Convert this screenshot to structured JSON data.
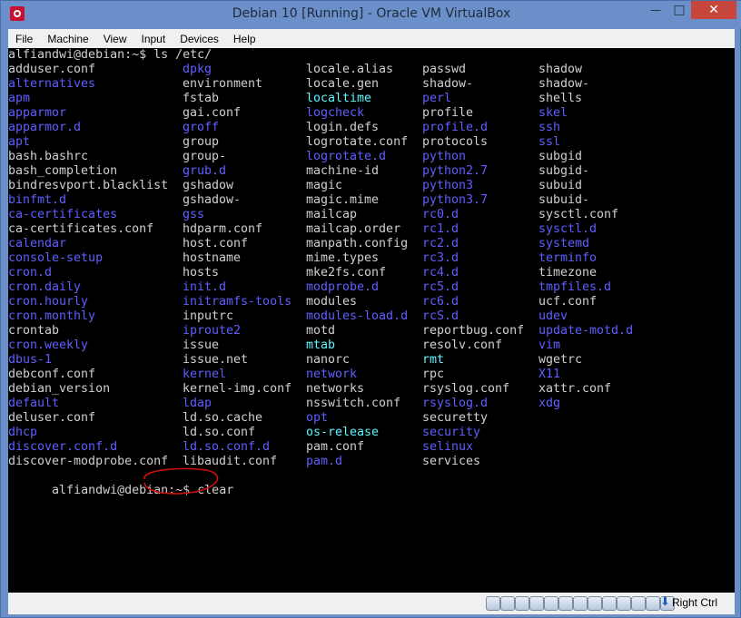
{
  "window": {
    "title": "Debian 10 [Running] - Oracle VM VirtualBox",
    "close_symbol": "✕",
    "min_symbol": "—",
    "max_symbol": "□"
  },
  "menubar": {
    "items": [
      "File",
      "Machine",
      "View",
      "Input",
      "Devices",
      "Help"
    ]
  },
  "terminal": {
    "prompt_line": "alfiandwi@debian:~$ ls /etc/",
    "final_prompt": "alfiandwi@debian:~$",
    "final_command": "clear",
    "colors": {
      "file": "#d0d0d0",
      "dir": "#5f5fff",
      "link": "#5ff5ff",
      "background": "#000000"
    },
    "rows": [
      [
        [
          "adduser.conf",
          "file"
        ],
        [
          "dpkg",
          "dir"
        ],
        [
          "locale.alias",
          "file"
        ],
        [
          "passwd",
          "file"
        ],
        [
          "shadow",
          "file"
        ]
      ],
      [
        [
          "alternatives",
          "dir"
        ],
        [
          "environment",
          "file"
        ],
        [
          "locale.gen",
          "file"
        ],
        [
          "shadow-",
          "file"
        ],
        [
          "shadow-",
          "file"
        ]
      ],
      [
        [
          "apm",
          "dir"
        ],
        [
          "fstab",
          "file"
        ],
        [
          "localtime",
          "link"
        ],
        [
          "perl",
          "dir"
        ],
        [
          "shells",
          "file"
        ]
      ],
      [
        [
          "apparmor",
          "dir"
        ],
        [
          "gai.conf",
          "file"
        ],
        [
          "logcheck",
          "dir"
        ],
        [
          "profile",
          "file"
        ],
        [
          "skel",
          "dir"
        ]
      ],
      [
        [
          "apparmor.d",
          "dir"
        ],
        [
          "groff",
          "dir"
        ],
        [
          "login.defs",
          "file"
        ],
        [
          "profile.d",
          "dir"
        ],
        [
          "ssh",
          "dir"
        ]
      ],
      [
        [
          "apt",
          "dir"
        ],
        [
          "group",
          "file"
        ],
        [
          "logrotate.conf",
          "file"
        ],
        [
          "protocols",
          "file"
        ],
        [
          "ssl",
          "dir"
        ]
      ],
      [
        [
          "bash.bashrc",
          "file"
        ],
        [
          "group-",
          "file"
        ],
        [
          "logrotate.d",
          "dir"
        ],
        [
          "python",
          "dir"
        ],
        [
          "subgid",
          "file"
        ]
      ],
      [
        [
          "bash_completion",
          "file"
        ],
        [
          "grub.d",
          "dir"
        ],
        [
          "machine-id",
          "file"
        ],
        [
          "python2.7",
          "dir"
        ],
        [
          "subgid-",
          "file"
        ]
      ],
      [
        [
          "bindresvport.blacklist",
          "file"
        ],
        [
          "gshadow",
          "file"
        ],
        [
          "magic",
          "file"
        ],
        [
          "python3",
          "dir"
        ],
        [
          "subuid",
          "file"
        ]
      ],
      [
        [
          "binfmt.d",
          "dir"
        ],
        [
          "gshadow-",
          "file"
        ],
        [
          "magic.mime",
          "file"
        ],
        [
          "python3.7",
          "dir"
        ],
        [
          "subuid-",
          "file"
        ]
      ],
      [
        [
          "ca-certificates",
          "dir"
        ],
        [
          "gss",
          "dir"
        ],
        [
          "mailcap",
          "file"
        ],
        [
          "rc0.d",
          "dir"
        ],
        [
          "sysctl.conf",
          "file"
        ]
      ],
      [
        [
          "ca-certificates.conf",
          "file"
        ],
        [
          "hdparm.conf",
          "file"
        ],
        [
          "mailcap.order",
          "file"
        ],
        [
          "rc1.d",
          "dir"
        ],
        [
          "sysctl.d",
          "dir"
        ]
      ],
      [
        [
          "calendar",
          "dir"
        ],
        [
          "host.conf",
          "file"
        ],
        [
          "manpath.config",
          "file"
        ],
        [
          "rc2.d",
          "dir"
        ],
        [
          "systemd",
          "dir"
        ]
      ],
      [
        [
          "console-setup",
          "dir"
        ],
        [
          "hostname",
          "file"
        ],
        [
          "mime.types",
          "file"
        ],
        [
          "rc3.d",
          "dir"
        ],
        [
          "terminfo",
          "dir"
        ]
      ],
      [
        [
          "cron.d",
          "dir"
        ],
        [
          "hosts",
          "file"
        ],
        [
          "mke2fs.conf",
          "file"
        ],
        [
          "rc4.d",
          "dir"
        ],
        [
          "timezone",
          "file"
        ]
      ],
      [
        [
          "cron.daily",
          "dir"
        ],
        [
          "init.d",
          "dir"
        ],
        [
          "modprobe.d",
          "dir"
        ],
        [
          "rc5.d",
          "dir"
        ],
        [
          "tmpfiles.d",
          "dir"
        ]
      ],
      [
        [
          "cron.hourly",
          "dir"
        ],
        [
          "initramfs-tools",
          "dir"
        ],
        [
          "modules",
          "file"
        ],
        [
          "rc6.d",
          "dir"
        ],
        [
          "ucf.conf",
          "file"
        ]
      ],
      [
        [
          "cron.monthly",
          "dir"
        ],
        [
          "inputrc",
          "file"
        ],
        [
          "modules-load.d",
          "dir"
        ],
        [
          "rcS.d",
          "dir"
        ],
        [
          "udev",
          "dir"
        ]
      ],
      [
        [
          "crontab",
          "file"
        ],
        [
          "iproute2",
          "dir"
        ],
        [
          "motd",
          "file"
        ],
        [
          "reportbug.conf",
          "file"
        ],
        [
          "update-motd.d",
          "dir"
        ]
      ],
      [
        [
          "cron.weekly",
          "dir"
        ],
        [
          "issue",
          "file"
        ],
        [
          "mtab",
          "link"
        ],
        [
          "resolv.conf",
          "file"
        ],
        [
          "vim",
          "dir"
        ]
      ],
      [
        [
          "dbus-1",
          "dir"
        ],
        [
          "issue.net",
          "file"
        ],
        [
          "nanorc",
          "file"
        ],
        [
          "rmt",
          "link"
        ],
        [
          "wgetrc",
          "file"
        ]
      ],
      [
        [
          "debconf.conf",
          "file"
        ],
        [
          "kernel",
          "dir"
        ],
        [
          "network",
          "dir"
        ],
        [
          "rpc",
          "file"
        ],
        [
          "X11",
          "dir"
        ]
      ],
      [
        [
          "debian_version",
          "file"
        ],
        [
          "kernel-img.conf",
          "file"
        ],
        [
          "networks",
          "file"
        ],
        [
          "rsyslog.conf",
          "file"
        ],
        [
          "xattr.conf",
          "file"
        ]
      ],
      [
        [
          "default",
          "dir"
        ],
        [
          "ldap",
          "dir"
        ],
        [
          "nsswitch.conf",
          "file"
        ],
        [
          "rsyslog.d",
          "dir"
        ],
        [
          "xdg",
          "dir"
        ]
      ],
      [
        [
          "deluser.conf",
          "file"
        ],
        [
          "ld.so.cache",
          "file"
        ],
        [
          "opt",
          "dir"
        ],
        [
          "securetty",
          "file"
        ],
        [
          "",
          ""
        ]
      ],
      [
        [
          "dhcp",
          "dir"
        ],
        [
          "ld.so.conf",
          "file"
        ],
        [
          "os-release",
          "link"
        ],
        [
          "security",
          "dir"
        ],
        [
          "",
          ""
        ]
      ],
      [
        [
          "discover.conf.d",
          "dir"
        ],
        [
          "ld.so.conf.d",
          "dir"
        ],
        [
          "pam.conf",
          "file"
        ],
        [
          "selinux",
          "dir"
        ],
        [
          "",
          ""
        ]
      ],
      [
        [
          "discover-modprobe.conf",
          "file"
        ],
        [
          "libaudit.conf",
          "file"
        ],
        [
          "pam.d",
          "dir"
        ],
        [
          "services",
          "file"
        ],
        [
          "",
          ""
        ]
      ]
    ]
  },
  "statusbar": {
    "host_key_label": "Right Ctrl",
    "icons": [
      "hard-disk-icon",
      "optical-drive-icon",
      "audio-icon",
      "network-icon",
      "usb-icon",
      "shared-folders-icon",
      "display-icon",
      "video-capture-icon",
      "cpu-icon",
      "mouse-integration-icon",
      "keyboard-icon",
      "virtualization-icon",
      "guest-additions-icon"
    ]
  }
}
